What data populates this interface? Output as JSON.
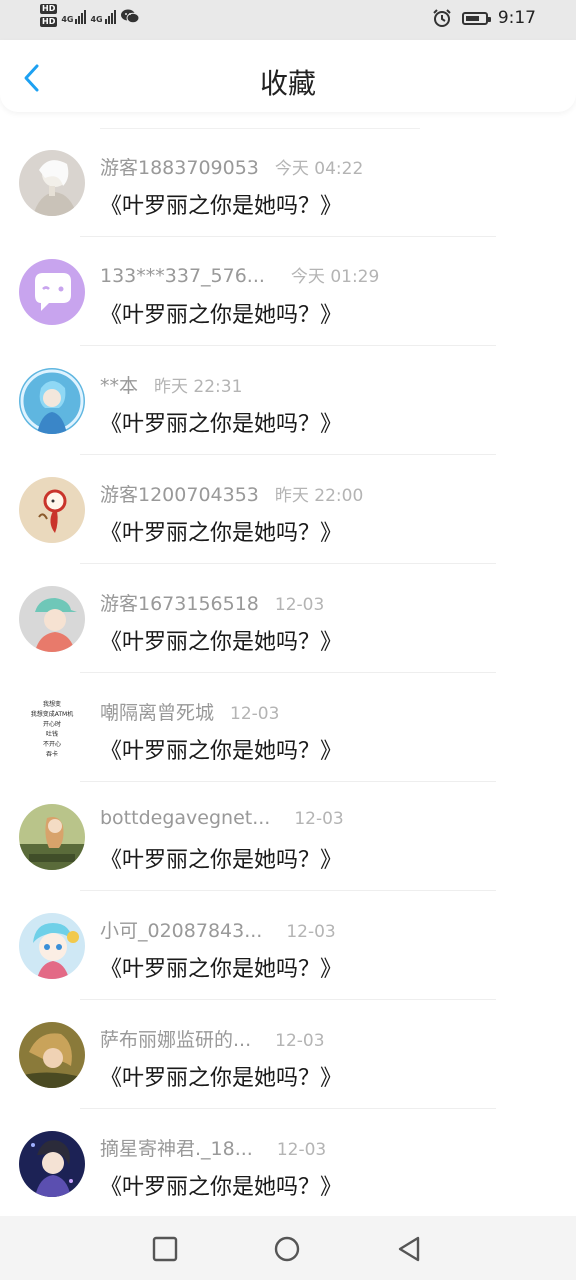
{
  "status_bar": {
    "hd1": "HD",
    "hd2": "HD",
    "net1": "4G",
    "net2": "4G",
    "time": "9:17",
    "icons": [
      "wechat-icon",
      "alarm-icon",
      "battery-icon"
    ]
  },
  "header": {
    "title": "收藏",
    "back_icon": "chevron-left-icon",
    "accent_color": "#1da1f2"
  },
  "items": [
    {
      "user": "游客1883709053",
      "time": "今天 04:22",
      "title": "《叶罗丽之你是她吗？》"
    },
    {
      "user": "133***337_576...",
      "time": "今天 01:29",
      "title": "《叶罗丽之你是她吗？》"
    },
    {
      "user": "**本",
      "time": "昨天 22:31",
      "title": "《叶罗丽之你是她吗？》"
    },
    {
      "user": "游客1200704353",
      "time": "昨天 22:00",
      "title": "《叶罗丽之你是她吗？》"
    },
    {
      "user": "游客1673156518",
      "time": "12-03",
      "title": "《叶罗丽之你是她吗？》"
    },
    {
      "user": "嘲隔离曾死城",
      "time": "12-03",
      "title": "《叶罗丽之你是她吗？》",
      "avatar_lines": [
        "我想变",
        "我想变成ATM机",
        "开心时",
        "吐钱",
        "不开心",
        "吞卡"
      ]
    },
    {
      "user": "bottdegavegnet...",
      "time": "12-03",
      "title": "《叶罗丽之你是她吗？》"
    },
    {
      "user": "小可_02087843...",
      "time": "12-03",
      "title": "《叶罗丽之你是她吗？》"
    },
    {
      "user": "萨布丽娜监研的...",
      "time": "12-03",
      "title": "《叶罗丽之你是她吗？》"
    },
    {
      "user": "摘星寄神君._18...",
      "time": "12-03",
      "title": "《叶罗丽之你是她吗？》"
    }
  ],
  "nav_bar": {
    "icons": [
      "recent-apps-icon",
      "home-icon",
      "back-icon"
    ]
  }
}
